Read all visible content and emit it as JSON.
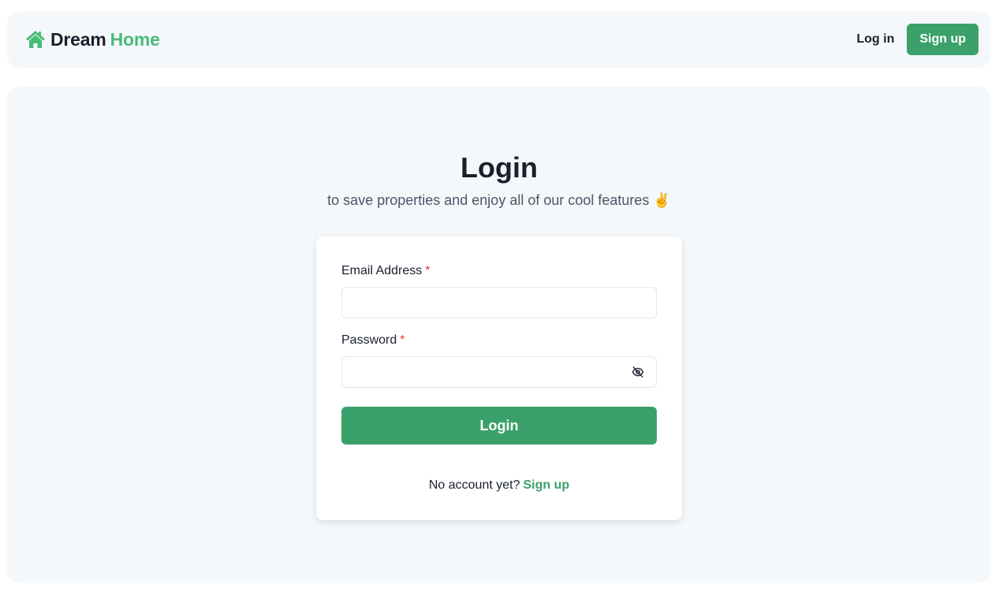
{
  "navbar": {
    "brand": {
      "part1": "Dream",
      "part2": "Home",
      "icon": "home-icon"
    },
    "login_label": "Log in",
    "signup_label": "Sign up"
  },
  "login_page": {
    "title": "Login",
    "subtitle": "to save properties and enjoy all of our cool features ✌️",
    "email": {
      "label": "Email Address",
      "required_mark": "*",
      "value": "",
      "placeholder": ""
    },
    "password": {
      "label": "Password",
      "required_mark": "*",
      "value": "",
      "placeholder": "",
      "toggle_icon": "eye-off-icon"
    },
    "submit_label": "Login",
    "footer": {
      "prompt": "No account yet?",
      "link": "Sign up"
    }
  },
  "colors": {
    "accent": "#3ba16a",
    "brand_green": "#48bb78",
    "required": "#e53e3e",
    "panel_bg": "#f5f8fb",
    "text": "#1a202c"
  }
}
